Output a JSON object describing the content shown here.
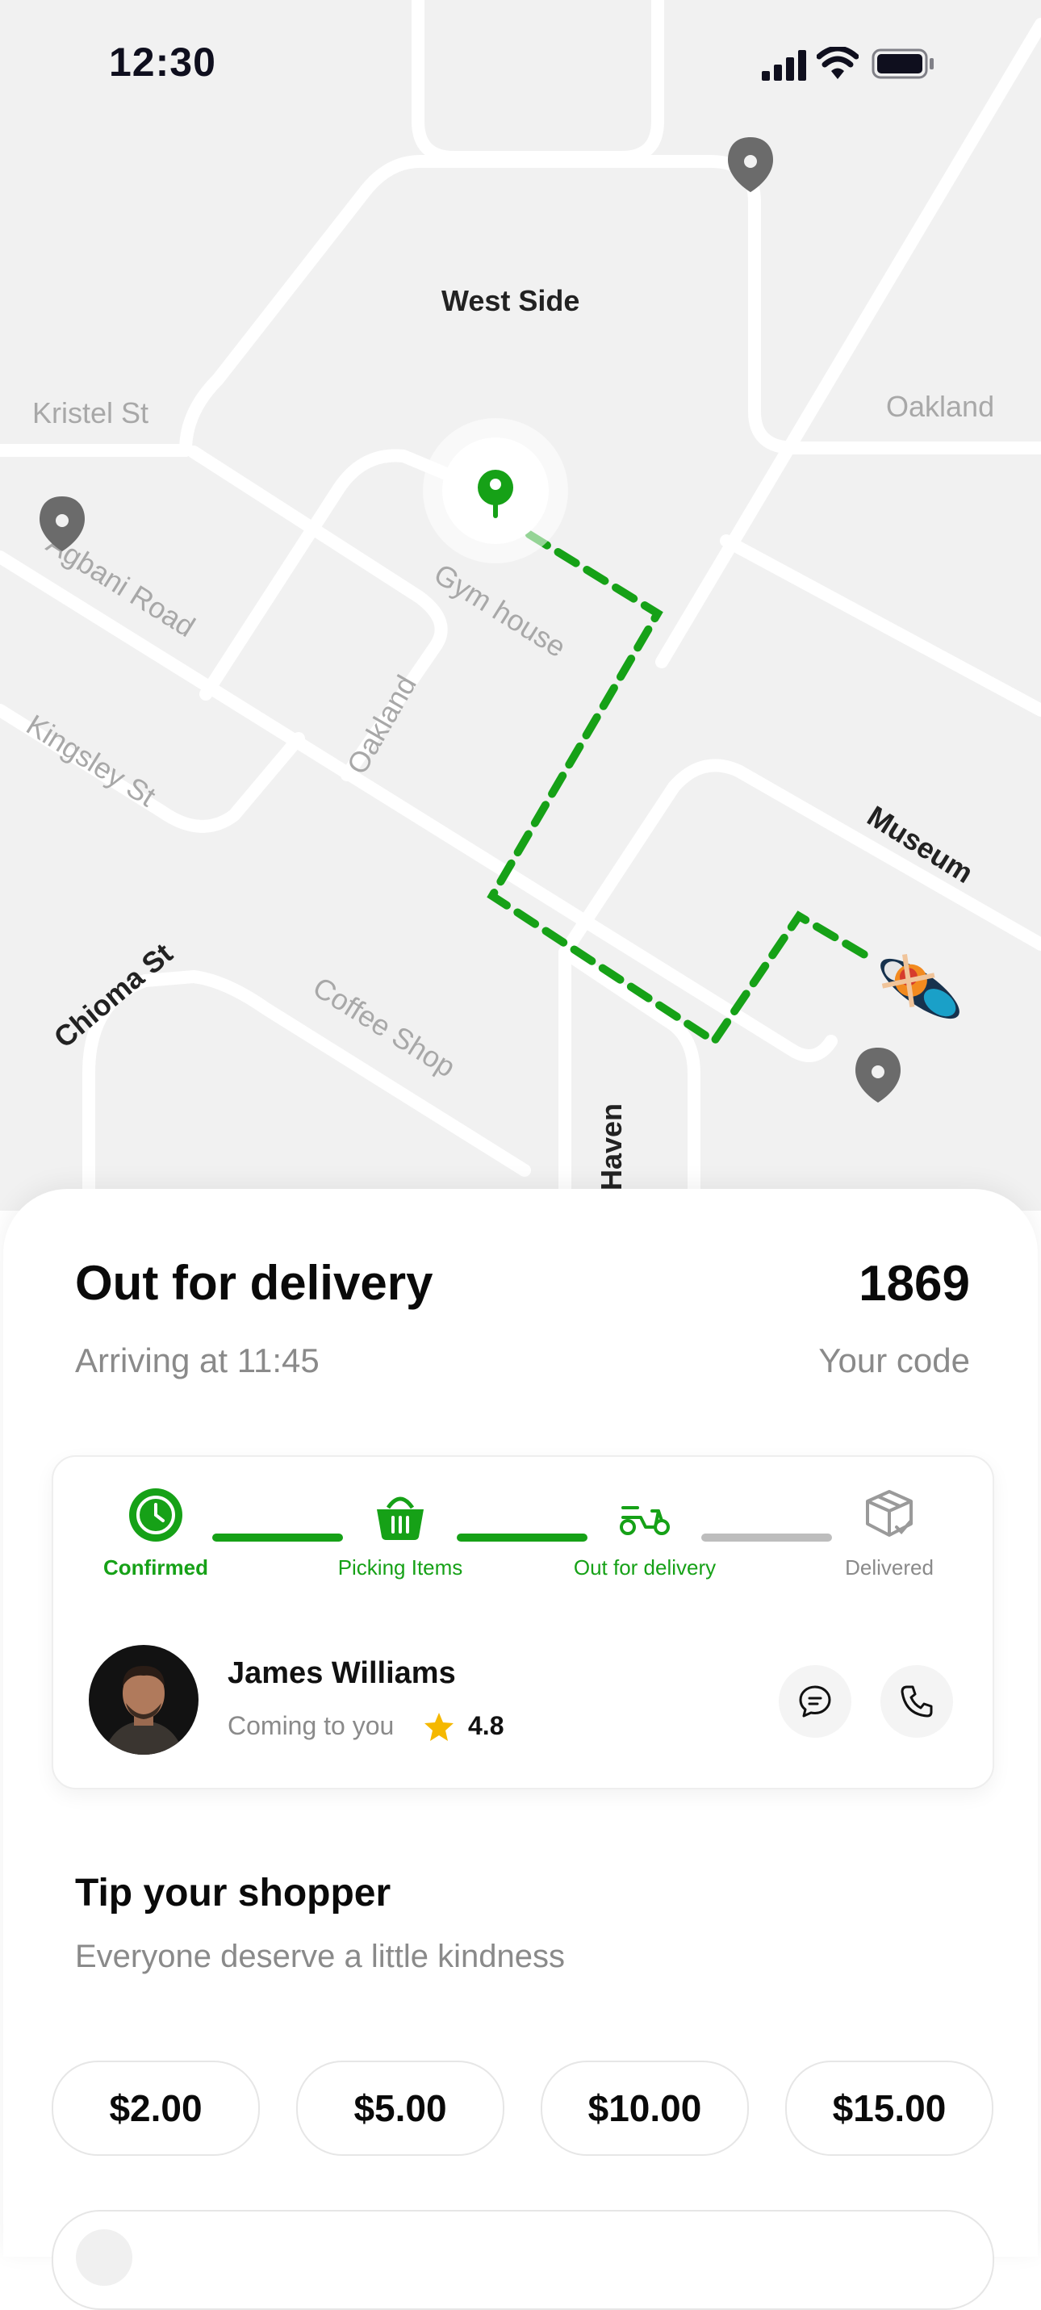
{
  "status_bar": {
    "time": "12:30"
  },
  "map": {
    "labels": {
      "west_side": "West Side",
      "kristel": "Kristel St",
      "oakland_right": "Oakland",
      "agbani": "Agbani Road",
      "gym": "Gym house",
      "kingsley": "Kingsley St",
      "oakland_mid": "Oakland",
      "museum": "Museum",
      "chioma": "Chioma St",
      "coffee": "Coffee Shop",
      "haven": "Haven"
    }
  },
  "delivery": {
    "title": "Out for delivery",
    "arriving": "Arriving at 11:45",
    "code": "1869",
    "code_label": "Your code"
  },
  "steps": [
    {
      "label": "Confirmed",
      "icon": "clock-icon",
      "state": "active"
    },
    {
      "label": "Picking Items",
      "icon": "basket-icon",
      "state": "done"
    },
    {
      "label": "Out for delivery",
      "icon": "scooter-icon",
      "state": "done"
    },
    {
      "label": "Delivered",
      "icon": "package-icon",
      "state": "pending"
    }
  ],
  "courier": {
    "name": "James Williams",
    "status": "Coming to you",
    "rating": "4.8"
  },
  "tip": {
    "title": "Tip your shopper",
    "subtitle": "Everyone deserve a little kindness",
    "options": [
      "$2.00",
      "$5.00",
      "$10.00",
      "$15.00"
    ]
  },
  "colors": {
    "accent": "#16a117",
    "muted": "#8a8a8a",
    "star": "#f5b800",
    "pending": "#bdbdbd"
  }
}
